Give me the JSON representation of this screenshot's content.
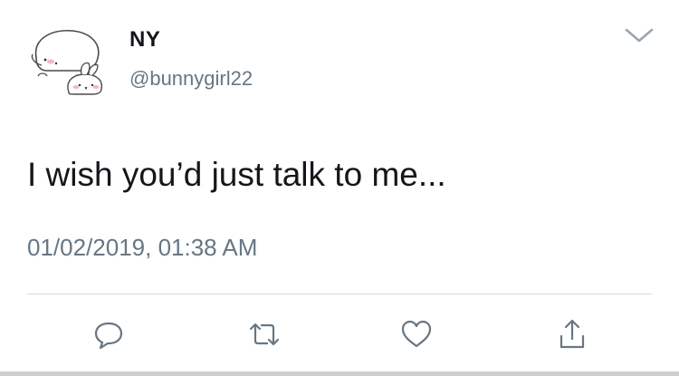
{
  "user": {
    "display_name": "NY",
    "handle": "@bunnygirl22",
    "avatar_icon": "bunny-avatar-icon"
  },
  "tweet": {
    "text": "I wish you’d just talk to me...",
    "timestamp": "01/02/2019, 01:38 AM"
  },
  "menu": {
    "icon": "chevron-down-icon"
  },
  "actions": [
    {
      "icon": "reply-icon"
    },
    {
      "icon": "retweet-icon"
    },
    {
      "icon": "like-icon"
    },
    {
      "icon": "share-icon"
    }
  ],
  "colors": {
    "text_primary": "#14171a",
    "text_secondary": "#657786",
    "icon_gray": "#657786",
    "divider": "#d6dbe0"
  }
}
